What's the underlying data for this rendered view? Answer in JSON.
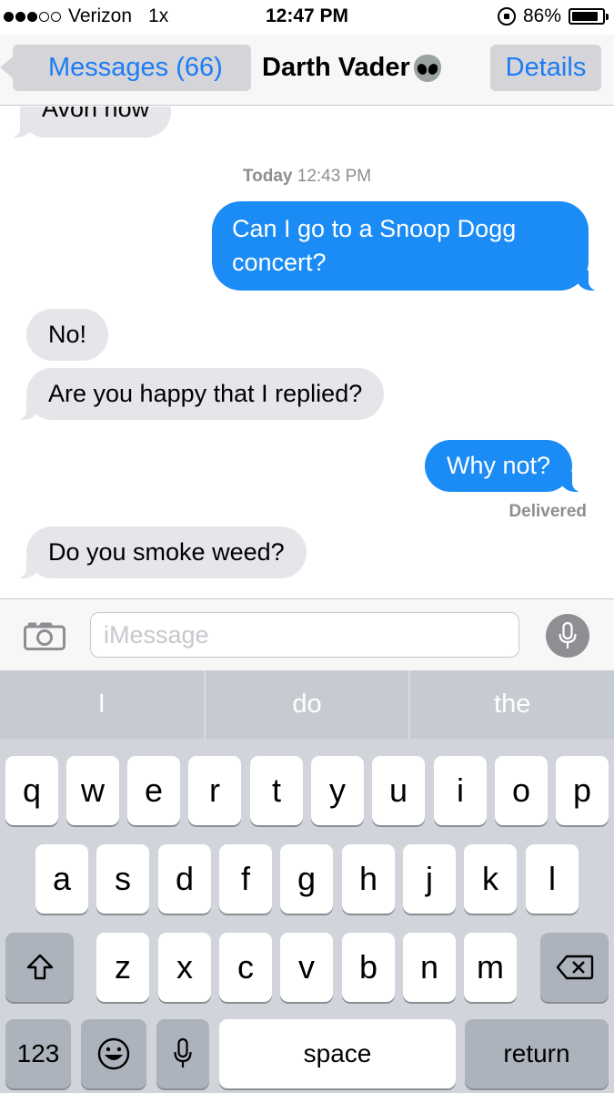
{
  "status_bar": {
    "carrier": "Verizon",
    "network": "1x",
    "time": "12:47 PM",
    "battery": "86%",
    "battery_level": 0.86,
    "signal_dots_filled": 3,
    "signal_dots_total": 5
  },
  "nav": {
    "back_label": "Messages (66)",
    "title": "Darth Vader",
    "title_icon": "alien-emoji-icon",
    "details_label": "Details"
  },
  "messages": {
    "partial_incoming": "Avon now",
    "timestamp_day": "Today",
    "timestamp_time": "12:43 PM",
    "items": [
      {
        "from": "me",
        "text": "Can I go to a Snoop Dogg concert?"
      },
      {
        "from": "them",
        "text": "No!"
      },
      {
        "from": "them",
        "text": "Are you happy that I replied?"
      },
      {
        "from": "me",
        "text": "Why not?"
      },
      {
        "from": "them",
        "text": "Do you smoke weed?"
      }
    ],
    "delivered_label": "Delivered"
  },
  "input_bar": {
    "placeholder": "iMessage",
    "camera_icon": "camera-icon",
    "mic_icon": "microphone-icon"
  },
  "predictive": [
    "I",
    "do",
    "the"
  ],
  "keyboard": {
    "row1": [
      "q",
      "w",
      "e",
      "r",
      "t",
      "y",
      "u",
      "i",
      "o",
      "p"
    ],
    "row2": [
      "a",
      "s",
      "d",
      "f",
      "g",
      "h",
      "j",
      "k",
      "l"
    ],
    "row3": [
      "z",
      "x",
      "c",
      "v",
      "b",
      "n",
      "m"
    ],
    "numbers_label": "123",
    "space_label": "space",
    "return_label": "return"
  },
  "colors": {
    "accent": "#1b7cf5",
    "outgoing_bubble": "#1b8cf5",
    "incoming_bubble": "#e5e5ea"
  }
}
